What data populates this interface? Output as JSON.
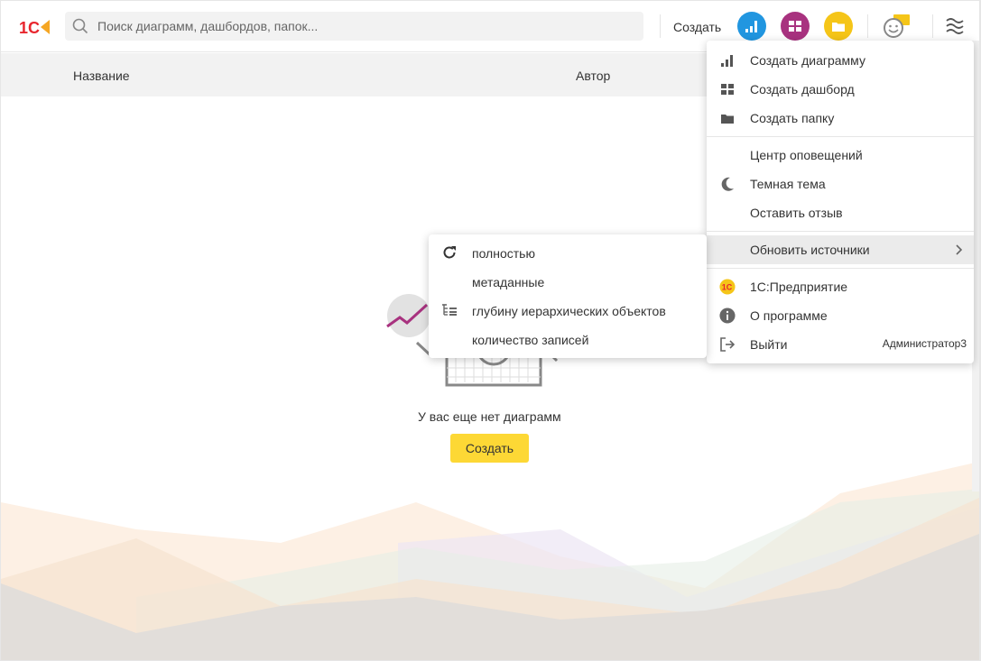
{
  "header": {
    "logo_text": "1С",
    "search_placeholder": "Поиск диаграмм, дашбордов, папок...",
    "create_label": "Создать"
  },
  "table": {
    "col_name": "Название",
    "col_author": "Автор"
  },
  "empty_state": {
    "text": "У вас еще нет диаграмм",
    "button": "Создать"
  },
  "menu": {
    "create_chart": "Создать диаграмму",
    "create_dashboard": "Создать дашборд",
    "create_folder": "Создать папку",
    "notification_center": "Центр оповещений",
    "dark_theme": "Темная тема",
    "leave_feedback": "Оставить отзыв",
    "refresh_sources": "Обновить источники",
    "enterprise": "1С:Предприятие",
    "about": "О программе",
    "logout": "Выйти",
    "user": "Администратор3"
  },
  "submenu": {
    "full": "полностью",
    "metadata": "метаданные",
    "hierarchy_depth": "глубину иерархических объектов",
    "record_count": "количество записей"
  },
  "colors": {
    "accent_yellow": "#fdd835",
    "chart_blue": "#2196e0",
    "dashboard_purple": "#a8327f",
    "folder_yellow": "#f5c518",
    "logo_red": "#e8262e"
  }
}
